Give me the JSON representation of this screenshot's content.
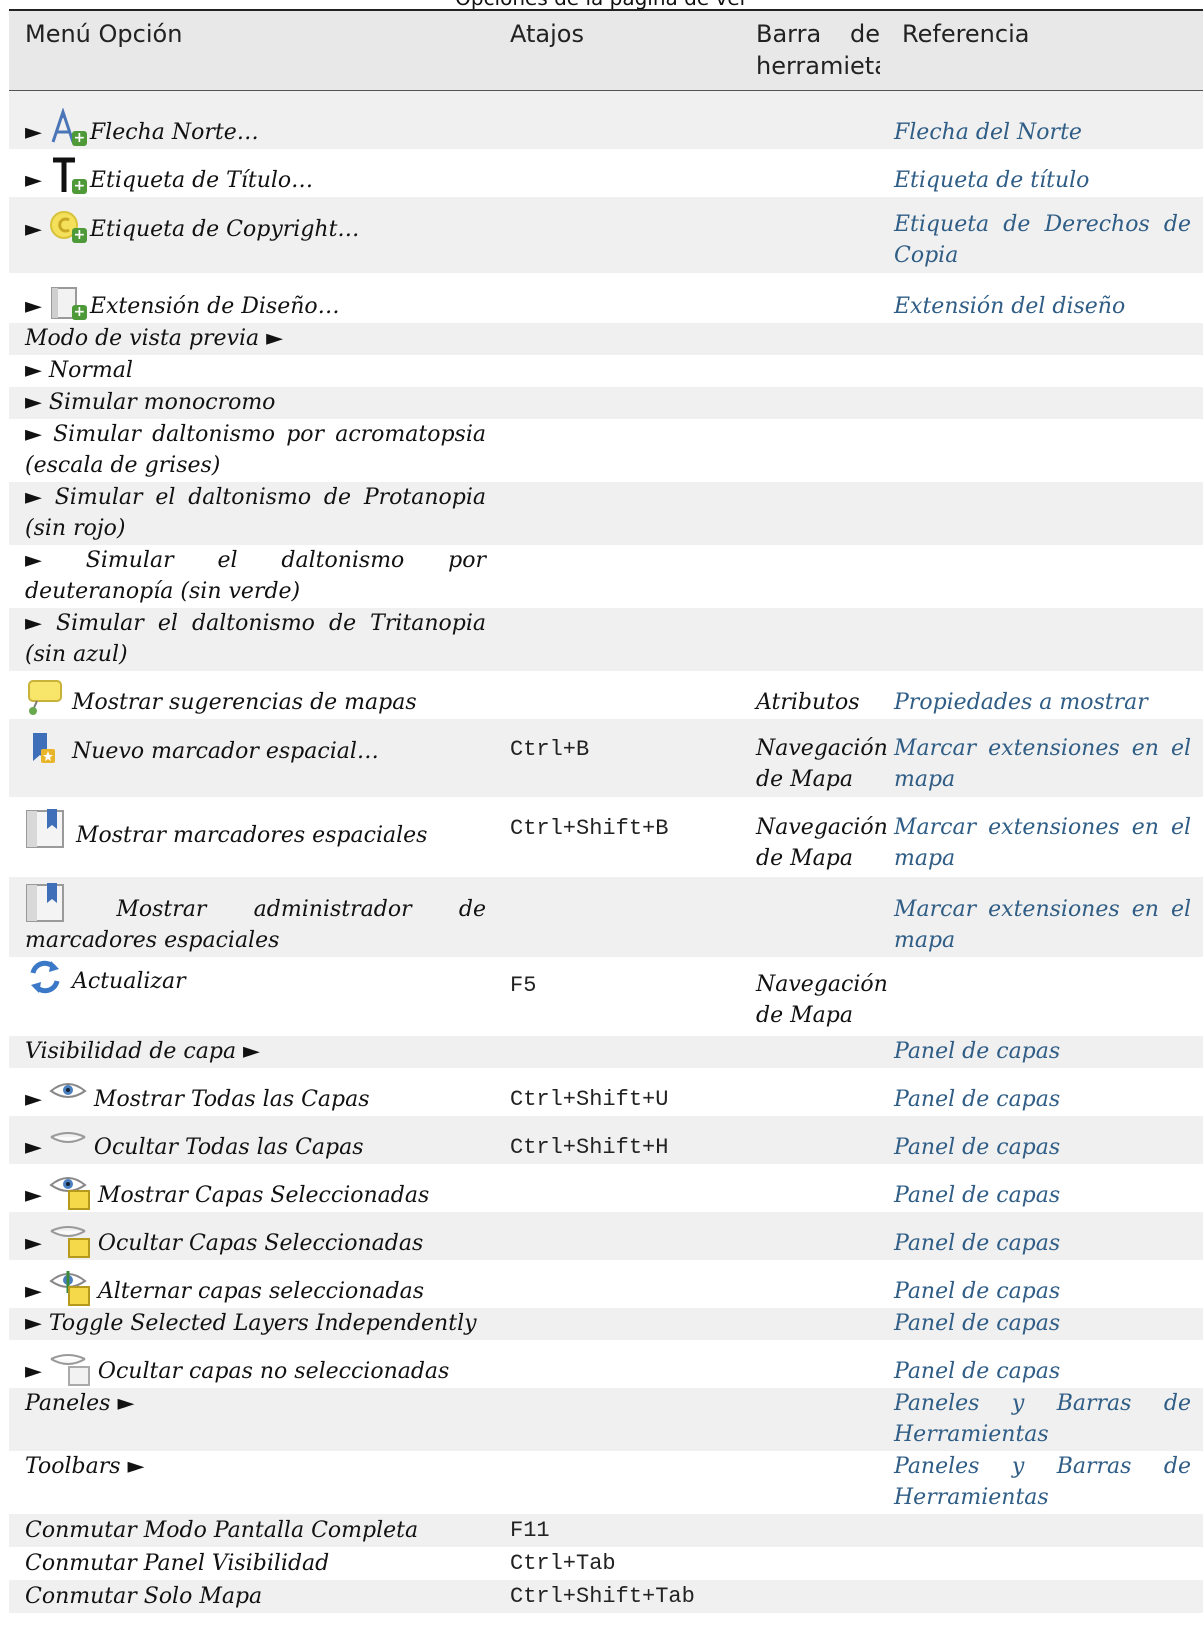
{
  "caption": "Opciones de la página de ver",
  "headers": {
    "menu": "Menú Opción",
    "shortcut": "Atajos",
    "toolbar": "Barra de herramietas",
    "reference": "Referencia"
  },
  "arrow": "►",
  "rows": [
    {
      "label": "Flecha Norte…",
      "reference": "Flecha del Norte"
    },
    {
      "label": "Etiqueta de Título…",
      "reference": "Etiqueta de título"
    },
    {
      "label": "Etiqueta de Copyright…",
      "reference": "Etiqueta de Derechos de Copia"
    },
    {
      "label": "Extensión de Diseño…",
      "reference": "Extensión del diseño"
    },
    {
      "label": "Modo de vista previa ►"
    },
    {
      "label": "Normal"
    },
    {
      "label": "Simular monocromo"
    },
    {
      "label": "Simular daltonismo por acromatopsia (escala de grises)"
    },
    {
      "label": "Simular el daltonismo de Protanopia (sin rojo)"
    },
    {
      "label": "Simular el daltonismo por deuteranopía (sin verde)"
    },
    {
      "label": "Simular el daltonismo de Tritanopia (sin azul)"
    },
    {
      "label": "Mostrar sugerencias de mapas",
      "toolbar": "Atributos",
      "reference": "Propiedades a mostrar"
    },
    {
      "label": "Nuevo marcador espacial…",
      "shortcut": "Ctrl+B",
      "toolbar": "Navegación de Mapa",
      "reference": "Marcar extensiones en el mapa"
    },
    {
      "label": "Mostrar marcadores espaciales",
      "shortcut": "Ctrl+Shift+B",
      "toolbar": "Navegación de Mapa",
      "reference": "Marcar extensiones en el mapa"
    },
    {
      "label": "Mostrar administrador de marcadores espaciales",
      "reference": "Marcar extensiones en el mapa"
    },
    {
      "label": "Actualizar",
      "shortcut": "F5",
      "toolbar": "Navegación de Mapa"
    },
    {
      "label": "Visibilidad de capa ►",
      "reference": "Panel de capas"
    },
    {
      "label": "Mostrar Todas las Capas",
      "shortcut": "Ctrl+Shift+U",
      "reference": "Panel de capas"
    },
    {
      "label": "Ocultar Todas las Capas",
      "shortcut": "Ctrl+Shift+H",
      "reference": "Panel de capas"
    },
    {
      "label": "Mostrar Capas Seleccionadas",
      "reference": "Panel de capas"
    },
    {
      "label": "Ocultar Capas Seleccionadas",
      "reference": "Panel de capas"
    },
    {
      "label": "Alternar capas seleccionadas",
      "reference": "Panel de capas"
    },
    {
      "label": "Toggle Selected Layers Independently",
      "reference": "Panel de capas"
    },
    {
      "label": "Ocultar capas no seleccionadas",
      "reference": "Panel de capas"
    },
    {
      "label": "Paneles ►",
      "reference": "Paneles y Barras de Herramientas"
    },
    {
      "label": "Toolbars ►",
      "reference": "Paneles y Barras de Herramientas"
    },
    {
      "label": "Conmutar Modo Pantalla Completa",
      "shortcut": "F11"
    },
    {
      "label": "Conmutar Panel Visibilidad",
      "shortcut": "Ctrl+Tab"
    },
    {
      "label": "Conmutar Solo Mapa",
      "shortcut": "Ctrl+Shift+Tab"
    }
  ],
  "icons": {
    "north_arrow": "north-arrow-add-icon",
    "title_label": "title-label-add-icon",
    "copyright": "copyright-add-icon",
    "layout_extent": "layout-extent-add-icon",
    "map_tips": "map-tips-icon",
    "new_bookmark": "new-bookmark-icon",
    "bookmarks": "bookmarks-icon",
    "refresh": "refresh-icon",
    "eye": "eye-icon",
    "eye_closed": "eye-closed-icon"
  },
  "colors": {
    "link": "#2f5d85",
    "header_bg": "#e8e8e8",
    "row_alt_bg": "#f0f0f0"
  }
}
